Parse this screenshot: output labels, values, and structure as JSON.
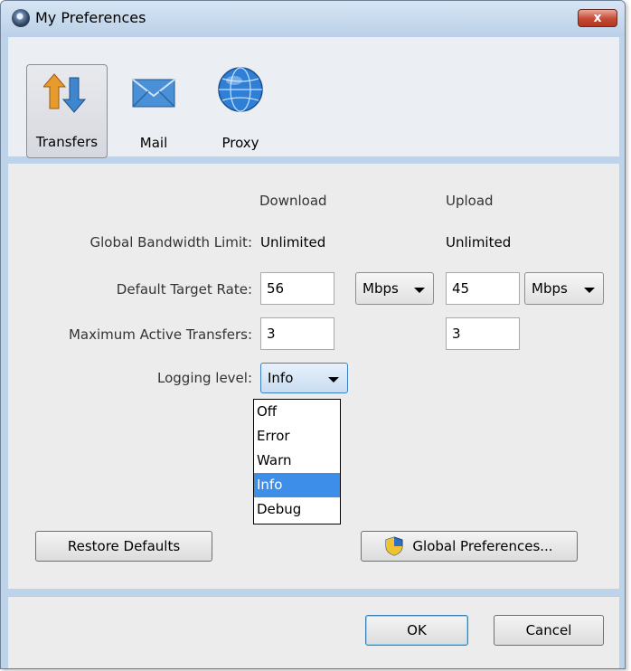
{
  "window": {
    "title": "My Preferences",
    "close_glyph": "x"
  },
  "toolbar": {
    "items": [
      {
        "label": "Transfers",
        "icon": "transfers-arrows-icon",
        "selected": true
      },
      {
        "label": "Mail",
        "icon": "mail-envelope-icon",
        "selected": false
      },
      {
        "label": "Proxy",
        "icon": "proxy-globe-icon",
        "selected": false
      }
    ]
  },
  "transfers": {
    "col_download": "Download",
    "col_upload": "Upload",
    "bandwidth_label": "Global Bandwidth Limit:",
    "download_bandwidth": "Unlimited",
    "upload_bandwidth": "Unlimited",
    "target_rate_label": "Default Target Rate:",
    "download_rate": "56",
    "download_rate_unit": "Mbps",
    "upload_rate": "45",
    "upload_rate_unit": "Mbps",
    "max_transfers_label": "Maximum Active Transfers:",
    "download_max": "3",
    "upload_max": "3",
    "logging_label": "Logging level:",
    "logging_value": "Info",
    "logging_options": [
      "Off",
      "Error",
      "Warn",
      "Info",
      "Debug"
    ],
    "restore_label": "Restore Defaults",
    "global_prefs_label": "Global Preferences..."
  },
  "footer": {
    "ok_label": "OK",
    "cancel_label": "Cancel"
  },
  "colors": {
    "selection": "#3d8ee8",
    "window_frame": "#bcd3ea",
    "close_button": "#c44a34"
  }
}
